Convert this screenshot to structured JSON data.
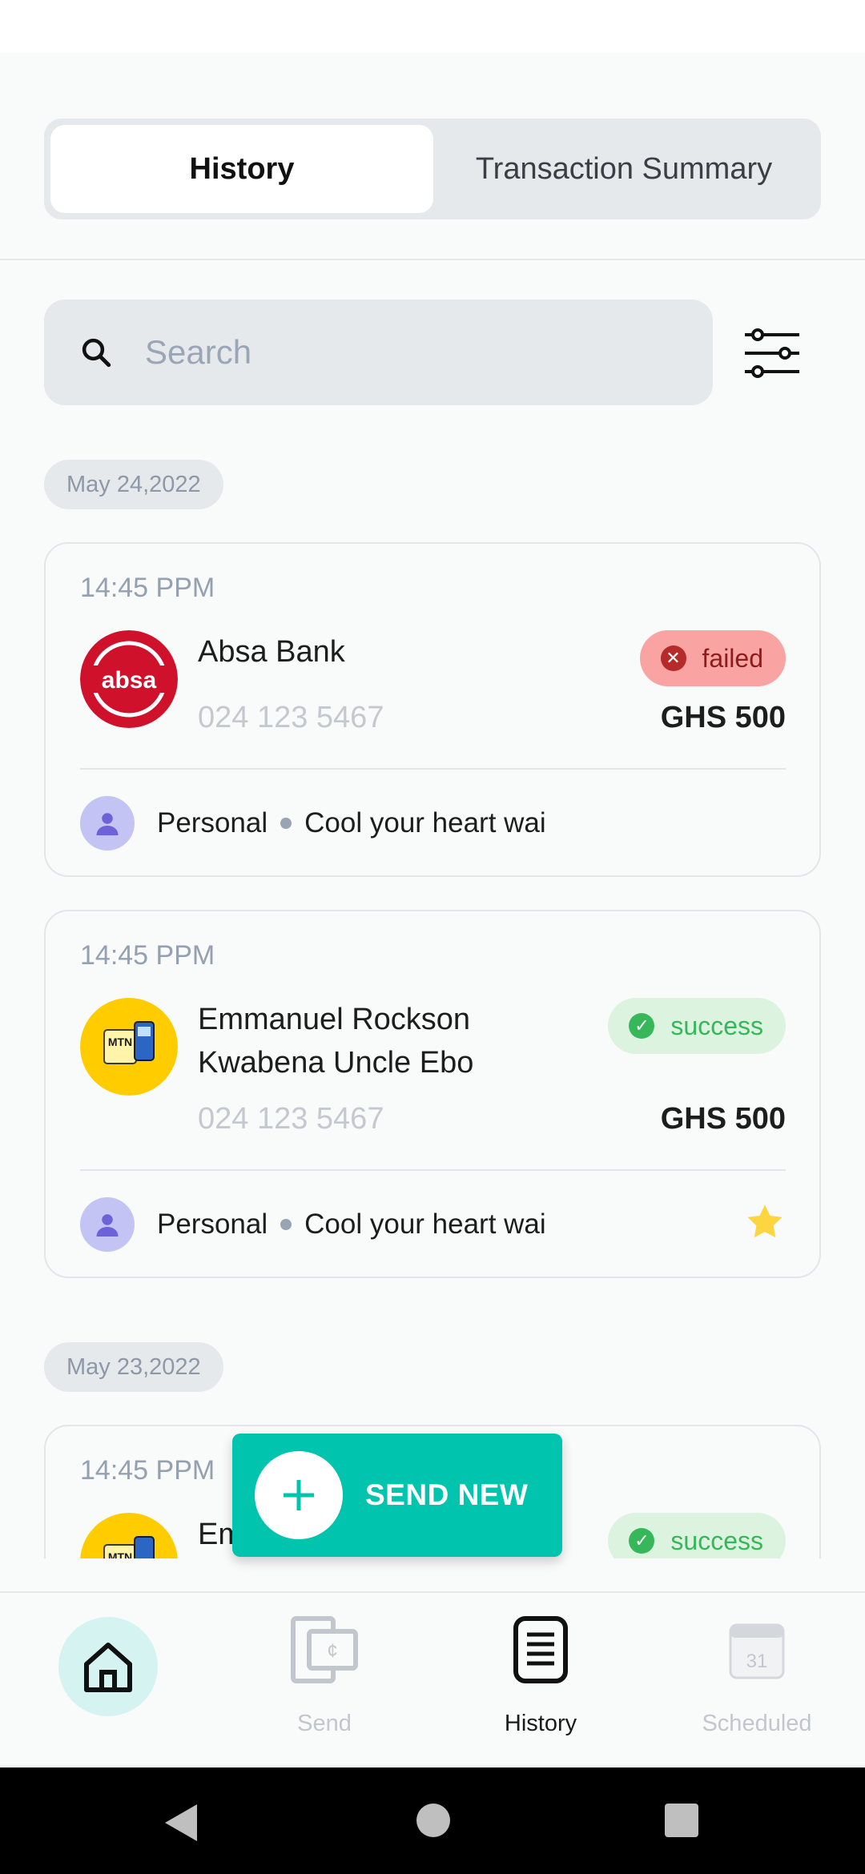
{
  "tabs": {
    "history": "History",
    "summary": "Transaction Summary"
  },
  "search": {
    "placeholder": "Search"
  },
  "groups": [
    {
      "date": "May 24,2022",
      "transactions": [
        {
          "time": "14:45 PPM",
          "name": "Absa Bank",
          "phone": "024 123 5467",
          "status": "failed",
          "amount": "GHS 500",
          "category": "Personal",
          "note": "Cool your heart wai",
          "logo": "absa-logo",
          "starred": false
        },
        {
          "time": "14:45 PPM",
          "name": "Emmanuel Rockson Kwabena Uncle Ebo",
          "phone": "024 123 5467",
          "status": "success",
          "amount": "GHS 500",
          "category": "Personal",
          "note": "Cool your heart wai",
          "logo": "mtn-mobile-money-logo",
          "starred": true
        }
      ]
    },
    {
      "date": "May 23,2022",
      "transactions": [
        {
          "time": "14:45 PPM",
          "name": "Em",
          "status": "success",
          "logo": "mtn-mobile-money-logo"
        }
      ]
    }
  ],
  "logos": {
    "absa_text": "absa",
    "mtn_text": "MTN"
  },
  "fab": {
    "label": "SEND NEW"
  },
  "nav": {
    "home": "",
    "send": "Send",
    "history": "History",
    "scheduled": "Scheduled",
    "calendar_day": "31"
  },
  "colors": {
    "accent": "#00c4ad",
    "failed_bg": "#f9a3a3",
    "success_bg": "#dcf3df",
    "absa_red": "#d0112b",
    "mtn_yellow": "#ffcc00"
  }
}
